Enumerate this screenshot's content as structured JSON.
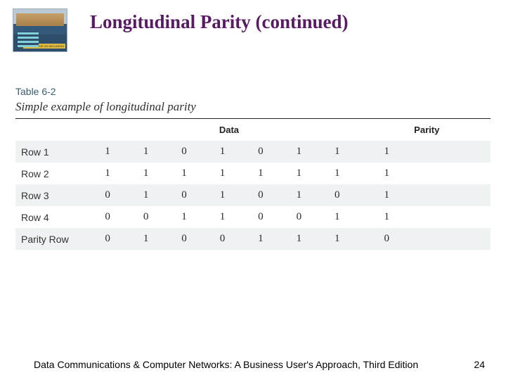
{
  "slide": {
    "title": "Longitudinal Parity (continued)",
    "book_tag": "INTERACTIVE CD INCLUDED!"
  },
  "table": {
    "number": "Table 6-2",
    "caption": "Simple example of longitudinal parity",
    "headers": {
      "data": "Data",
      "parity": "Parity"
    },
    "rows": [
      {
        "label": "Row 1",
        "bits": [
          "1",
          "1",
          "0",
          "1",
          "0",
          "1",
          "1"
        ],
        "parity": "1"
      },
      {
        "label": "Row 2",
        "bits": [
          "1",
          "1",
          "1",
          "1",
          "1",
          "1",
          "1"
        ],
        "parity": "1"
      },
      {
        "label": "Row 3",
        "bits": [
          "0",
          "1",
          "0",
          "1",
          "0",
          "1",
          "0"
        ],
        "parity": "1"
      },
      {
        "label": "Row 4",
        "bits": [
          "0",
          "0",
          "1",
          "1",
          "0",
          "0",
          "1"
        ],
        "parity": "1"
      },
      {
        "label": "Parity Row",
        "bits": [
          "0",
          "1",
          "0",
          "0",
          "1",
          "1",
          "1"
        ],
        "parity": "0"
      }
    ]
  },
  "footer": {
    "text": "Data Communications & Computer Networks: A Business User's Approach, Third Edition",
    "page": "24"
  }
}
